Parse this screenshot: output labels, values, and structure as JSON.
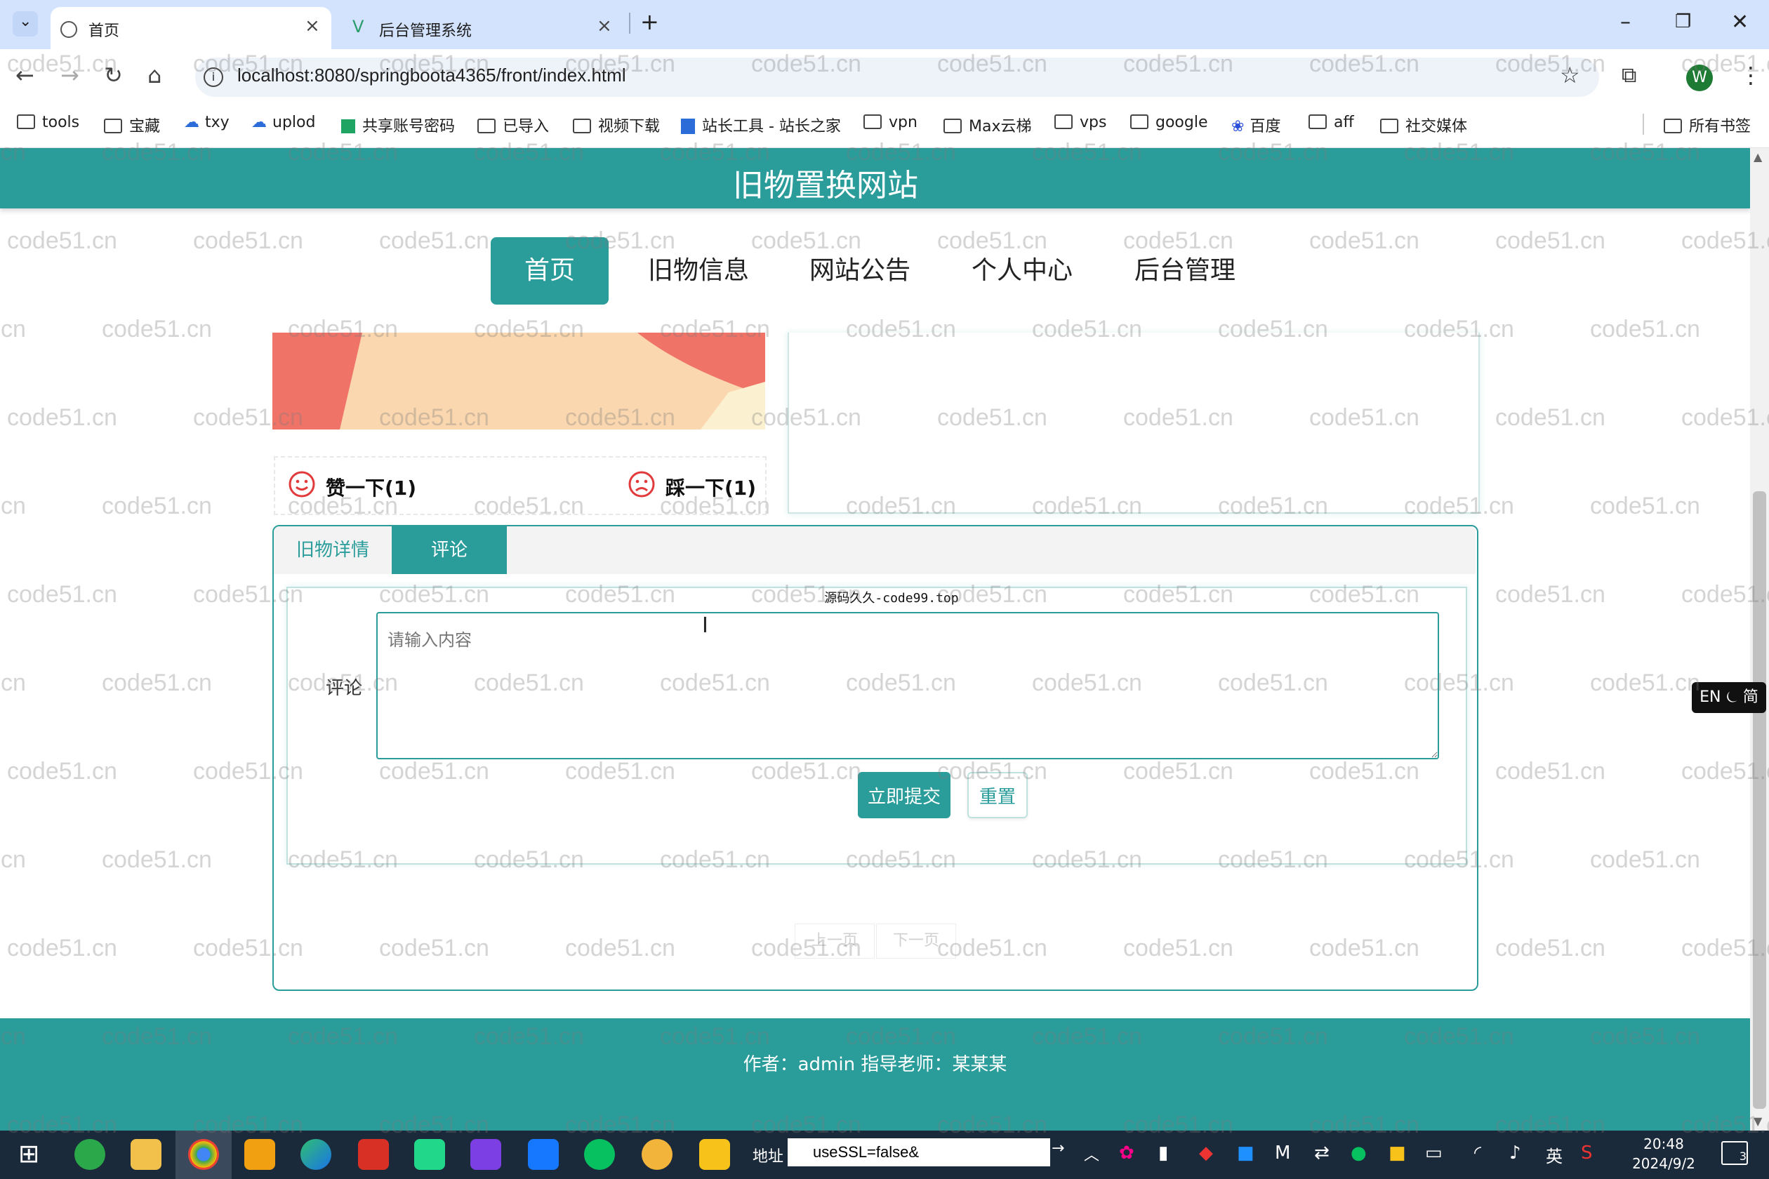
{
  "browser": {
    "tabs": [
      {
        "title": "首页",
        "active": true
      },
      {
        "title": "后台管理系统",
        "active": false
      }
    ],
    "new_tab": "+",
    "url": "localhost:8080/springboota4365/front/index.html",
    "bookmarks": [
      "tools",
      "宝藏",
      "txy",
      "uplod",
      "共享账号密码",
      "已导入",
      "视频下载",
      "站长工具 - 站长之家",
      "vpn",
      "Max云梯",
      "vps",
      "google",
      "百度",
      "aff",
      "社交媒体"
    ],
    "all_bookmarks": "所有书签",
    "profile_initial": "W"
  },
  "site": {
    "title": "旧物置换网站",
    "nav": [
      "首页",
      "旧物信息",
      "网站公告",
      "个人中心",
      "后台管理"
    ],
    "active_nav": "首页",
    "like_label": "赞一下(1)",
    "dislike_label": "踩一下(1)",
    "panel_tabs": [
      "旧物详情",
      "评论"
    ],
    "active_panel_tab": "评论",
    "source_note": "源码久久-code99.top",
    "comment_label": "评论",
    "comment_placeholder": "请输入内容",
    "submit_label": "立即提交",
    "reset_label": "重置",
    "prev_page": "上一页",
    "next_page": "下一页",
    "footer": "作者：admin 指导老师：某某某",
    "watermark": "code51.cn",
    "accent_color": "#2a9d9b"
  },
  "ime": "EN ⏾ 简",
  "taskbar": {
    "address_label": "地址",
    "address_value": "useSSL=false&",
    "lang": "英",
    "time": "20:48",
    "date": "2024/9/2",
    "notifications": "3"
  }
}
